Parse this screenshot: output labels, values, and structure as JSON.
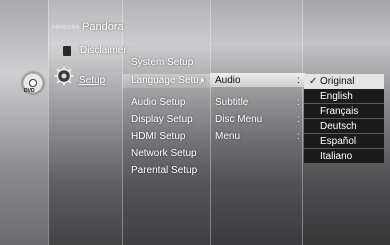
{
  "brand": {
    "logo_text": "PANDORA",
    "title": "Pandora"
  },
  "left_nav": {
    "disclaimer_label": "Disclaimer",
    "setup_label": "Setup",
    "disc_badge": "DVD"
  },
  "setup_menu": {
    "items": [
      {
        "label": "System Setup"
      },
      {
        "label": "Language Setup"
      },
      {
        "label": "Audio Setup"
      },
      {
        "label": "Display Setup"
      },
      {
        "label": "HDMI Setup"
      },
      {
        "label": "Network Setup"
      },
      {
        "label": "Parental Setup"
      }
    ]
  },
  "language_menu": {
    "items": [
      {
        "label": "Audio"
      },
      {
        "label": "Subtitle"
      },
      {
        "label": "Disc Menu"
      },
      {
        "label": "Menu"
      }
    ],
    "separator": ":"
  },
  "audio_options": {
    "selected": "Original",
    "items": [
      {
        "label": "Original"
      },
      {
        "label": "English"
      },
      {
        "label": "Français"
      },
      {
        "label": "Deutsch"
      },
      {
        "label": "Español"
      },
      {
        "label": "Italiano"
      }
    ]
  },
  "colors": {
    "highlight": "#e4e4e4",
    "dropdown_bg": "#1b1b1b",
    "text": "#ffffff"
  }
}
